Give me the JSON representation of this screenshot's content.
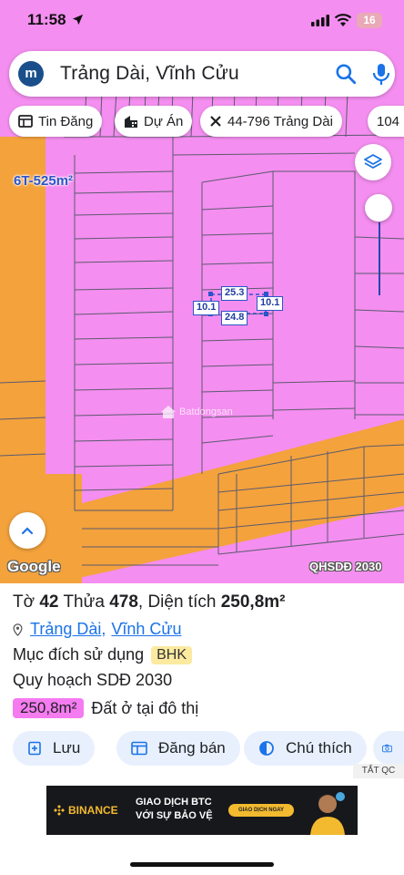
{
  "status_bar": {
    "time": "11:58",
    "battery": "16"
  },
  "search": {
    "avatar_letter": "m",
    "query": "Trảng Dài, Vĩnh Cửu"
  },
  "chips": [
    {
      "label": "Tin Đăng",
      "icon": "list-icon"
    },
    {
      "label": "Dự Án",
      "icon": "building-icon"
    },
    {
      "label": "44-796 Trảng Dài",
      "icon": "close-x-icon"
    },
    {
      "label": "104",
      "icon": ""
    }
  ],
  "map": {
    "area_label": "6T-525m²",
    "dimensions": {
      "top": "25.3",
      "left": "10.1",
      "right": "10.1",
      "bottom": "24.8"
    },
    "watermark": "Batdongsan",
    "google_logo": "Google",
    "layer_label": "QHSDĐ 2030",
    "colors": {
      "residential": "#f48ef0",
      "road": "#f4a23c",
      "outline": "#5b5b6e",
      "dimension": "#2a55c8"
    }
  },
  "parcel": {
    "sheet_label": "Tờ",
    "sheet_number": "42",
    "plot_label": "Thửa",
    "plot_number": "478",
    "area_label": "Diện tích",
    "area_value": "250,8m²",
    "ward": "Trảng Dài",
    "district": "Vĩnh Cửu",
    "purpose_label": "Mục đích sử dụng",
    "purpose_code": "BHK",
    "plan_label": "Quy hoạch SDĐ 2030",
    "landuse_area": "250,8m²",
    "landuse_desc": "Đất ở tại đô thị"
  },
  "actions": {
    "save": "Lưu",
    "post_sale": "Đăng bán",
    "legend": "Chú thích"
  },
  "ad": {
    "close_label": "TẮT QC",
    "brand": "BINANCE",
    "headline_1": "GIAO DỊCH BTC",
    "headline_2": "VỚI SỰ BẢO VỆ",
    "cta": "GIAO DỊCH NGAY"
  }
}
